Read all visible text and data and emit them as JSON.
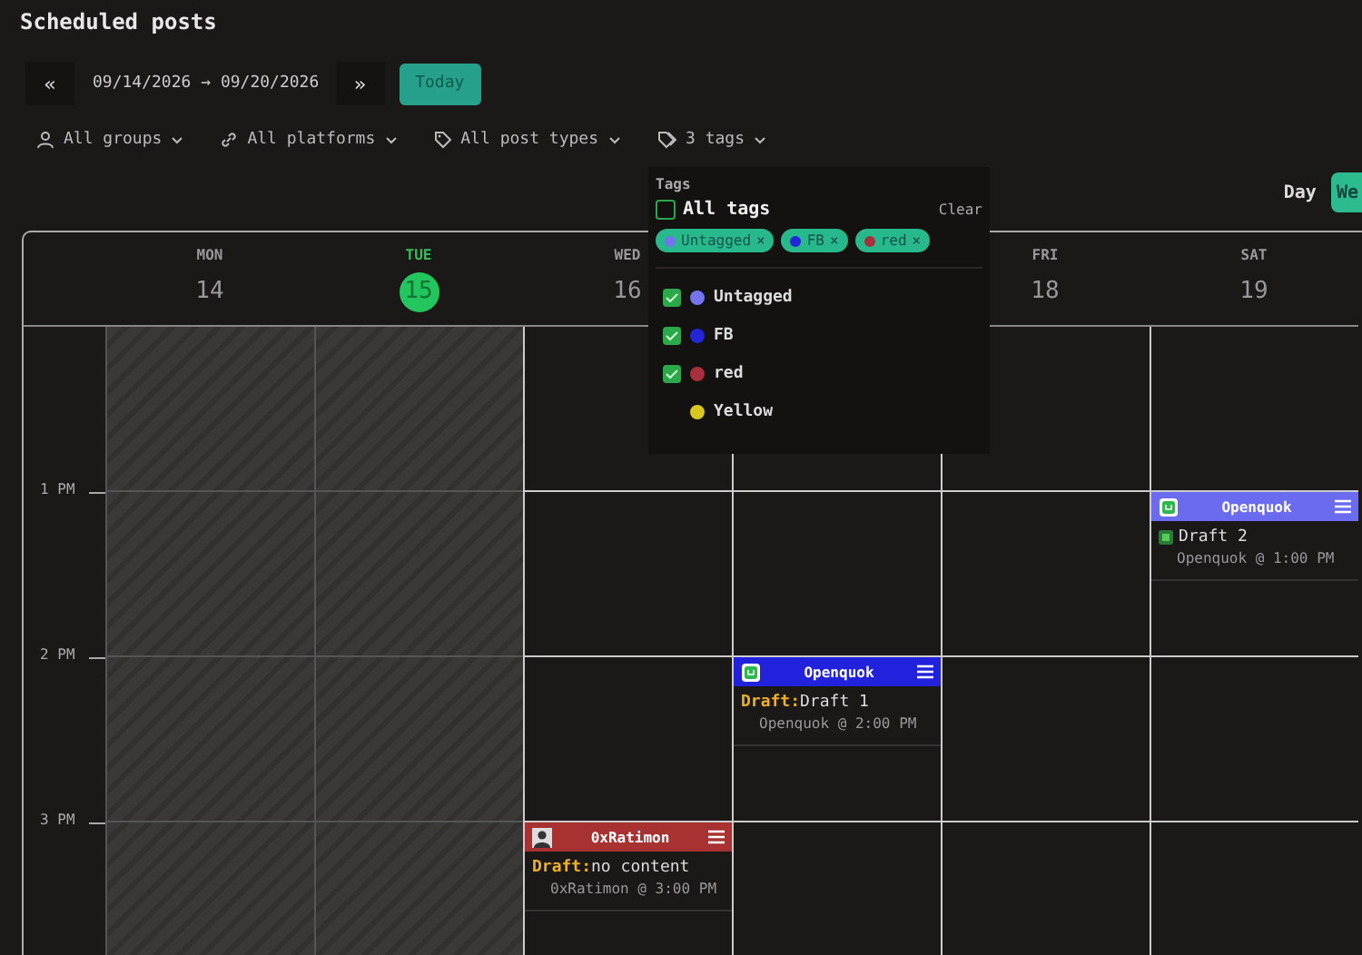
{
  "title": "Scheduled posts",
  "date_nav": {
    "prev": "«",
    "range": "09/14/2026 → 09/20/2026",
    "next": "»",
    "today": "Today"
  },
  "filters": [
    {
      "kind": "groups",
      "label": "All groups"
    },
    {
      "kind": "platforms",
      "label": "All platforms"
    },
    {
      "kind": "types",
      "label": "All post types"
    },
    {
      "kind": "tags",
      "label": "3 tags"
    }
  ],
  "view_toggle": [
    {
      "label": "Day",
      "selected": false
    },
    {
      "label": "We",
      "selected": true
    }
  ],
  "days": [
    {
      "name": "MON",
      "date": "14",
      "today": false
    },
    {
      "name": "TUE",
      "date": "15",
      "today": true
    },
    {
      "name": "WED",
      "date": "16",
      "today": false
    },
    {
      "name": "FRI",
      "date": "18",
      "today": false
    },
    {
      "name": "SAT",
      "date": "19",
      "today": false
    }
  ],
  "rows": [
    {
      "cells": [
        {
          "past": true
        },
        {
          "past": true
        },
        {
          "past": false
        },
        {
          "past": false
        },
        {
          "past": false
        },
        {
          "past": false
        }
      ]
    },
    {
      "label": "1 PM",
      "cells": [
        {
          "past": true
        },
        {
          "past": true
        },
        {
          "past": false
        },
        {
          "past": false
        },
        {
          "past": false
        },
        {
          "past": false,
          "event": {
            "kind": "preview",
            "avatar": {
              "kind": "app"
            },
            "account": "Openquok",
            "color": "#6b6bf0",
            "title": "Draft 2",
            "meta": "Openquok @ 1:00 PM"
          }
        }
      ]
    },
    {
      "label": "2 PM",
      "cells": [
        {
          "past": true
        },
        {
          "past": true
        },
        {
          "past": false
        },
        {
          "past": false,
          "event": {
            "kind": "draft",
            "avatar": {
              "kind": "app"
            },
            "account": "Openquok",
            "color": "#2222dd",
            "prefix": "Draft:",
            "title": "Draft 1",
            "meta": "Openquok @ 2:00 PM"
          }
        },
        {
          "past": false
        },
        {
          "past": false
        }
      ]
    },
    {
      "label": "3 PM",
      "cells": [
        {
          "past": true
        },
        {
          "past": true
        },
        {
          "past": false,
          "event": {
            "kind": "draft",
            "avatar": {
              "kind": "user"
            },
            "account": "0xRatimon",
            "color": "#a83232",
            "prefix": "Draft:",
            "title": "no content",
            "meta": "0xRatimon @ 3:00 PM"
          }
        },
        {
          "past": false
        },
        {
          "past": false
        },
        {
          "past": false
        }
      ]
    }
  ],
  "tag_menu": {
    "heading": "Tags",
    "all_label": "All tags",
    "all_checked": false,
    "clear": "Clear",
    "chips": [
      {
        "label": "Untagged",
        "color": "#7474f2",
        "remove": "×"
      },
      {
        "label": "FB",
        "color": "#2424d8",
        "remove": "×"
      },
      {
        "label": "red",
        "color": "#a8303c",
        "remove": "×"
      }
    ],
    "options": [
      {
        "label": "Untagged",
        "color": "#7474f2",
        "checked": true
      },
      {
        "label": "FB",
        "color": "#2424d8",
        "checked": true
      },
      {
        "label": "red",
        "color": "#a8303c",
        "checked": true
      },
      {
        "label": "Yellow",
        "color": "#d8c81e",
        "checked": false
      }
    ]
  }
}
